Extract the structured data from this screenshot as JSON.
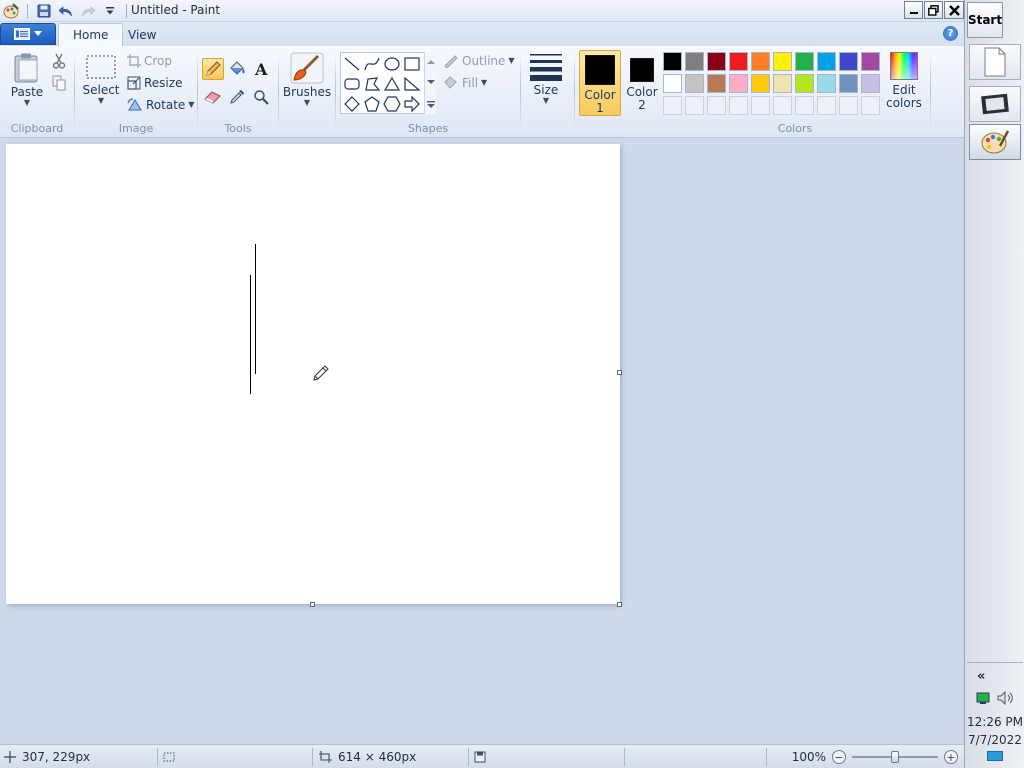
{
  "window": {
    "title": "Untitled - Paint"
  },
  "tabs": [
    {
      "label": "Home",
      "active": true
    },
    {
      "label": "View",
      "active": false
    }
  ],
  "ribbon": {
    "clipboard": {
      "label": "Clipboard",
      "paste": "Paste"
    },
    "image": {
      "label": "Image",
      "select": "Select",
      "crop": "Crop",
      "resize": "Resize",
      "rotate": "Rotate"
    },
    "tools": {
      "label": "Tools",
      "selected_tool": "pencil"
    },
    "brushes": {
      "label": "Brushes"
    },
    "shapes": {
      "label": "Shapes",
      "outline": "Outline",
      "fill": "Fill"
    },
    "size": {
      "label": "Size"
    },
    "color1": {
      "label_line1": "Color",
      "label_line2": "1",
      "value": "#000000"
    },
    "color2": {
      "label_line1": "Color",
      "label_line2": "2",
      "value": "#000000"
    },
    "colors": {
      "label": "Colors",
      "row1": [
        "#000000",
        "#7f7f7f",
        "#880015",
        "#ed1c24",
        "#ff7f27",
        "#fff200",
        "#22b14c",
        "#00a2e8",
        "#3f48cc",
        "#a349a4"
      ],
      "row2": [
        "#ffffff",
        "#c3c3c3",
        "#b97a57",
        "#ffaec9",
        "#ffc90e",
        "#efe4b0",
        "#b5e61d",
        "#99d9ea",
        "#7092be",
        "#c8bfe7"
      ],
      "edit_line1": "Edit",
      "edit_line2": "colors"
    }
  },
  "status": {
    "cursor_pos": "307, 229px",
    "image_size": "614 × 460px",
    "zoom": "100%",
    "zoom_level_fraction": 0.5
  },
  "taskbar": {
    "start": "Start",
    "time": "12:26 PM",
    "date": "7/7/2022"
  }
}
